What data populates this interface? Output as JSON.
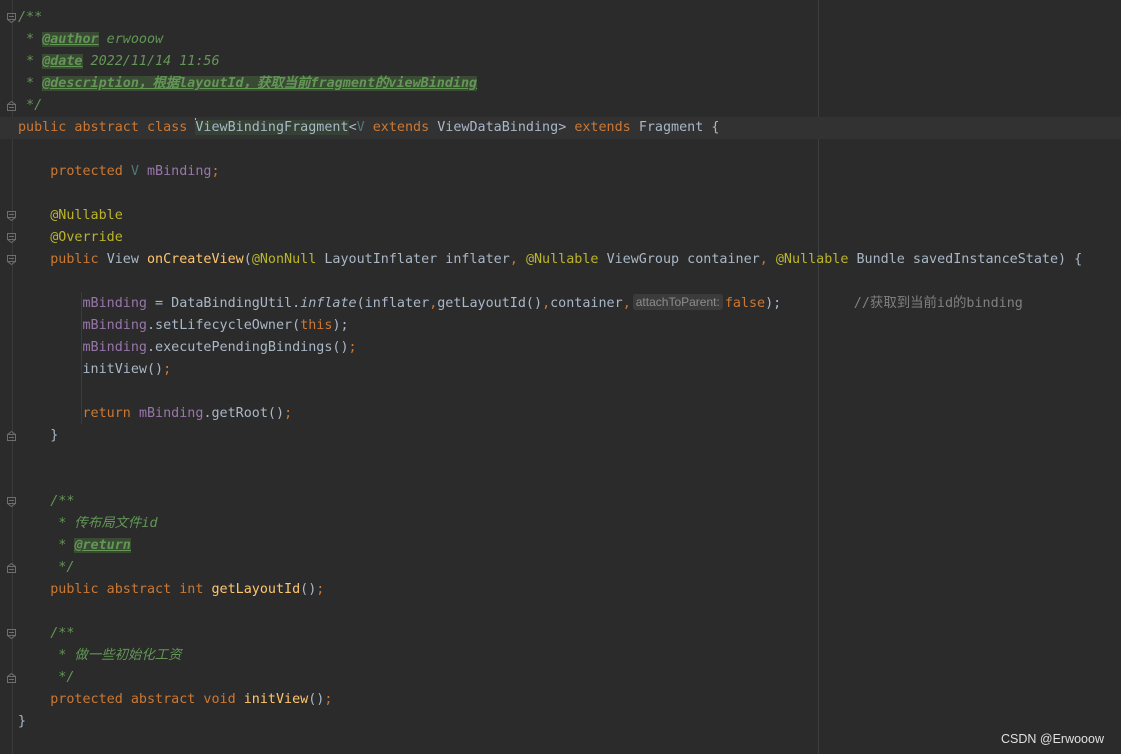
{
  "editor": {
    "language": "java",
    "lines": [
      {
        "fold": "open",
        "tokens": [
          {
            "t": "/**",
            "c": "cm"
          }
        ]
      },
      {
        "fold": "",
        "tokens": [
          {
            "t": " * ",
            "c": "cm"
          },
          {
            "t": "@author",
            "c": "tag"
          },
          {
            "t": " erwooow",
            "c": "cm"
          }
        ]
      },
      {
        "fold": "",
        "tokens": [
          {
            "t": " * ",
            "c": "cm"
          },
          {
            "t": "@date",
            "c": "tag"
          },
          {
            "t": " 2022/11/14 11:56",
            "c": "cm"
          }
        ]
      },
      {
        "fold": "",
        "tokens": [
          {
            "t": " * ",
            "c": "cm"
          },
          {
            "t": "@description，根据layoutId，获取当前fragment的viewBinding",
            "c": "tag"
          }
        ]
      },
      {
        "fold": "close",
        "tokens": [
          {
            "t": " */",
            "c": "cm"
          }
        ]
      },
      {
        "fold": "",
        "caret_row": true,
        "tokens": [
          {
            "t": "public abstract class ",
            "c": "kw"
          },
          {
            "t": "",
            "c": "caret"
          },
          {
            "t": "ViewBindingFragment",
            "c": "cls-hl"
          },
          {
            "t": "<",
            "c": "pl"
          },
          {
            "t": "V",
            "c": "tp"
          },
          {
            "t": " extends ",
            "c": "kw"
          },
          {
            "t": "ViewDataBinding",
            "c": "pl"
          },
          {
            "t": "> ",
            "c": "pl"
          },
          {
            "t": "extends ",
            "c": "kw"
          },
          {
            "t": "Fragment {",
            "c": "pl"
          }
        ]
      },
      {
        "fold": "",
        "tokens": []
      },
      {
        "fold": "",
        "tokens": [
          {
            "t": "    protected ",
            "c": "kw"
          },
          {
            "t": "V ",
            "c": "tp"
          },
          {
            "t": "mBinding",
            "c": "fd"
          },
          {
            "t": ";",
            "c": "kw"
          }
        ]
      },
      {
        "fold": "",
        "tokens": []
      },
      {
        "fold": "open",
        "tokens": [
          {
            "t": "    @Nullable",
            "c": "an"
          }
        ]
      },
      {
        "fold": "open",
        "tokens": [
          {
            "t": "    @Override",
            "c": "an"
          }
        ]
      },
      {
        "fold": "open",
        "tokens": [
          {
            "t": "    public ",
            "c": "kw"
          },
          {
            "t": "View ",
            "c": "pl"
          },
          {
            "t": "onCreateView",
            "c": "fn"
          },
          {
            "t": "(",
            "c": "pl"
          },
          {
            "t": "@NonNull ",
            "c": "an"
          },
          {
            "t": "LayoutInflater inflater",
            "c": "pl"
          },
          {
            "t": ", ",
            "c": "kw"
          },
          {
            "t": "@Nullable ",
            "c": "an"
          },
          {
            "t": "ViewGroup container",
            "c": "pl"
          },
          {
            "t": ", ",
            "c": "kw"
          },
          {
            "t": "@Nullable ",
            "c": "an"
          },
          {
            "t": "Bundle savedInstanceState) {",
            "c": "pl"
          }
        ]
      },
      {
        "fold": "",
        "tokens": []
      },
      {
        "fold": "",
        "tokens": [
          {
            "t": "        ",
            "c": "pl"
          },
          {
            "t": "mBinding",
            "c": "fd"
          },
          {
            "t": " = DataBindingUtil.",
            "c": "pl"
          },
          {
            "t": "inflate",
            "c": "it"
          },
          {
            "t": "(inflater",
            "c": "pl"
          },
          {
            "t": ",",
            "c": "kw"
          },
          {
            "t": "getLayoutId()",
            "c": "pl"
          },
          {
            "t": ",",
            "c": "kw"
          },
          {
            "t": "container",
            "c": "pl"
          },
          {
            "t": ",",
            "c": "kw"
          },
          {
            "t": "attachToParent:",
            "c": "hint"
          },
          {
            "t": "false",
            "c": "kw"
          },
          {
            "t": ");",
            "c": "pl"
          },
          {
            "t": "         //获取到当前id的binding",
            "c": "gr"
          }
        ]
      },
      {
        "fold": "",
        "tokens": [
          {
            "t": "        ",
            "c": "pl"
          },
          {
            "t": "mBinding",
            "c": "fd"
          },
          {
            "t": ".setLifecycleOwner(",
            "c": "pl"
          },
          {
            "t": "this",
            "c": "kw"
          },
          {
            "t": ");",
            "c": "pl"
          }
        ]
      },
      {
        "fold": "",
        "tokens": [
          {
            "t": "        ",
            "c": "pl"
          },
          {
            "t": "mBinding",
            "c": "fd"
          },
          {
            "t": ".executePendingBindings()",
            "c": "pl"
          },
          {
            "t": ";",
            "c": "kw"
          }
        ]
      },
      {
        "fold": "",
        "tokens": [
          {
            "t": "        initView()",
            "c": "pl"
          },
          {
            "t": ";",
            "c": "kw"
          }
        ]
      },
      {
        "fold": "",
        "tokens": []
      },
      {
        "fold": "",
        "tokens": [
          {
            "t": "        return ",
            "c": "kw"
          },
          {
            "t": "mBinding",
            "c": "fd"
          },
          {
            "t": ".getRoot()",
            "c": "pl"
          },
          {
            "t": ";",
            "c": "kw"
          }
        ]
      },
      {
        "fold": "close",
        "tokens": [
          {
            "t": "    }",
            "c": "pl"
          }
        ]
      },
      {
        "fold": "",
        "tokens": []
      },
      {
        "fold": "",
        "tokens": []
      },
      {
        "fold": "open",
        "tokens": [
          {
            "t": "    /**",
            "c": "cm"
          }
        ]
      },
      {
        "fold": "",
        "tokens": [
          {
            "t": "     * 传布局文件id",
            "c": "cm"
          }
        ]
      },
      {
        "fold": "",
        "tokens": [
          {
            "t": "     * ",
            "c": "cm"
          },
          {
            "t": "@return",
            "c": "tag"
          }
        ]
      },
      {
        "fold": "close",
        "tokens": [
          {
            "t": "     */",
            "c": "cm"
          }
        ]
      },
      {
        "fold": "",
        "tokens": [
          {
            "t": "    public abstract int ",
            "c": "kw"
          },
          {
            "t": "getLayoutId",
            "c": "fn"
          },
          {
            "t": "()",
            "c": "pl"
          },
          {
            "t": ";",
            "c": "kw"
          }
        ]
      },
      {
        "fold": "",
        "tokens": []
      },
      {
        "fold": "open",
        "tokens": [
          {
            "t": "    /**",
            "c": "cm"
          }
        ]
      },
      {
        "fold": "",
        "tokens": [
          {
            "t": "     * 做一些初始化工资",
            "c": "cm"
          }
        ]
      },
      {
        "fold": "close",
        "tokens": [
          {
            "t": "     */",
            "c": "cm"
          }
        ]
      },
      {
        "fold": "",
        "tokens": [
          {
            "t": "    protected abstract void ",
            "c": "kw"
          },
          {
            "t": "initView",
            "c": "fn"
          },
          {
            "t": "()",
            "c": "pl"
          },
          {
            "t": ";",
            "c": "kw"
          }
        ]
      },
      {
        "fold": "",
        "tokens": [
          {
            "t": "}",
            "c": "pl"
          }
        ]
      }
    ]
  },
  "watermark": "CSDN @Erwooow",
  "colors": {
    "background": "#2b2b2b",
    "keyword": "#cc7832",
    "comment": "#629755",
    "field": "#9876aa",
    "annotation": "#bbb529",
    "method": "#ffc66d"
  }
}
